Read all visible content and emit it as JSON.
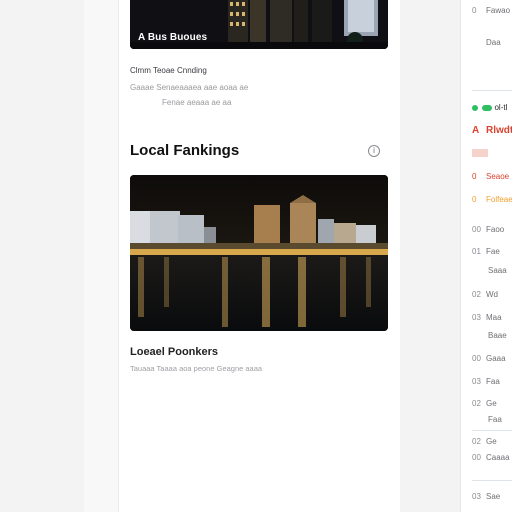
{
  "top_card": {
    "caption": "A Bus Buoues",
    "meta_line": "Clmm Teoae Cnnding",
    "detail_line": "Gaaae Senaeaaaea aae aoaa ae",
    "footer_line": "Fenae aeaaa ae aa"
  },
  "section": {
    "title": "Local Fankings",
    "info_icon": "i"
  },
  "main_card": {
    "title": "Loeael Poonkers",
    "subtitle": "Tauaaa Taaaa aoa peone Geagne aaaa"
  },
  "sidebar": {
    "items": [
      {
        "num": "0",
        "label": "Fawao"
      },
      {
        "num": "",
        "label": "Daa"
      },
      {
        "num": "",
        "label": "ol-tl"
      },
      {
        "num": "A",
        "label": "Rlwdt"
      },
      {
        "num": "0",
        "label": "Seaoe"
      },
      {
        "num": "0",
        "label": "Folfeae"
      },
      {
        "num": "00",
        "label": "Faoo"
      },
      {
        "num": "01",
        "label": "Fae"
      },
      {
        "num": "",
        "label": "Saaa"
      },
      {
        "num": "02",
        "label": "Wd"
      },
      {
        "num": "03",
        "label": "Maa"
      },
      {
        "num": "",
        "label": "Baae"
      },
      {
        "num": "00",
        "label": "Gaaa"
      },
      {
        "num": "03",
        "label": "Faa"
      },
      {
        "num": "02",
        "label": "Ge"
      },
      {
        "num": "",
        "label": "Faa"
      },
      {
        "num": "02",
        "label": "Ge"
      },
      {
        "num": "00",
        "label": "Caaaa"
      },
      {
        "num": "03",
        "label": "Sae"
      }
    ]
  },
  "colors": {
    "accent_green": "#2fbf62",
    "accent_red": "#d9432f",
    "accent_orange": "#f0a030",
    "accent_blue": "#cfd8ea"
  },
  "icons": {
    "info": "info-icon",
    "status_dot": "status-dot-icon"
  }
}
